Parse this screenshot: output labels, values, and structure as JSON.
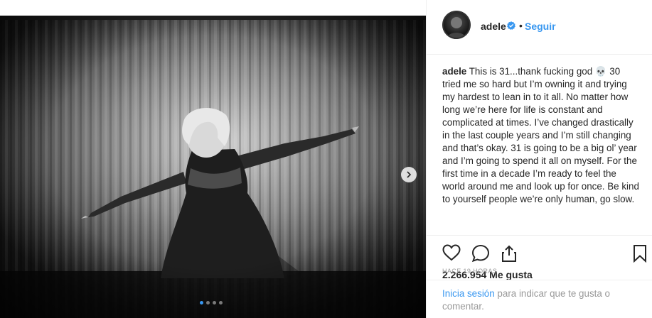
{
  "post": {
    "image_alt": "Black and white photo of a woman in a metallic dress posing in front of a curtain",
    "carousel_dots": 4,
    "active_dot": 0
  },
  "header": {
    "username": "adele",
    "separator": "•",
    "follow_label": "Seguir"
  },
  "caption": {
    "username": "adele",
    "text": "This is 31...thank fucking god 💀 30 tried me so hard but I’m owning it and trying my hardest to lean in to it all. No matter how long we’re here for life is constant and complicated at times. I’ve changed drastically in the last couple years and I’m still changing and that’s okay. 31 is going to be a big ol’ year and I’m going to spend it all on myself. For the first time in a decade I’m ready to feel the world around me and look up for once. Be kind to yourself people we’re only human, go slow."
  },
  "actions": {
    "like_icon": "heart-icon",
    "comment_icon": "comment-icon",
    "share_icon": "share-icon",
    "save_icon": "bookmark-icon"
  },
  "likes": {
    "text": "2.266.954 Me gusta"
  },
  "time": {
    "text": "HACE 19 HORAS"
  },
  "login": {
    "link": "Inicia sesión",
    "text": " para indicar que te gusta o comentar."
  },
  "colors": {
    "accent": "#3897f0",
    "text": "#262626",
    "muted": "#999999"
  }
}
